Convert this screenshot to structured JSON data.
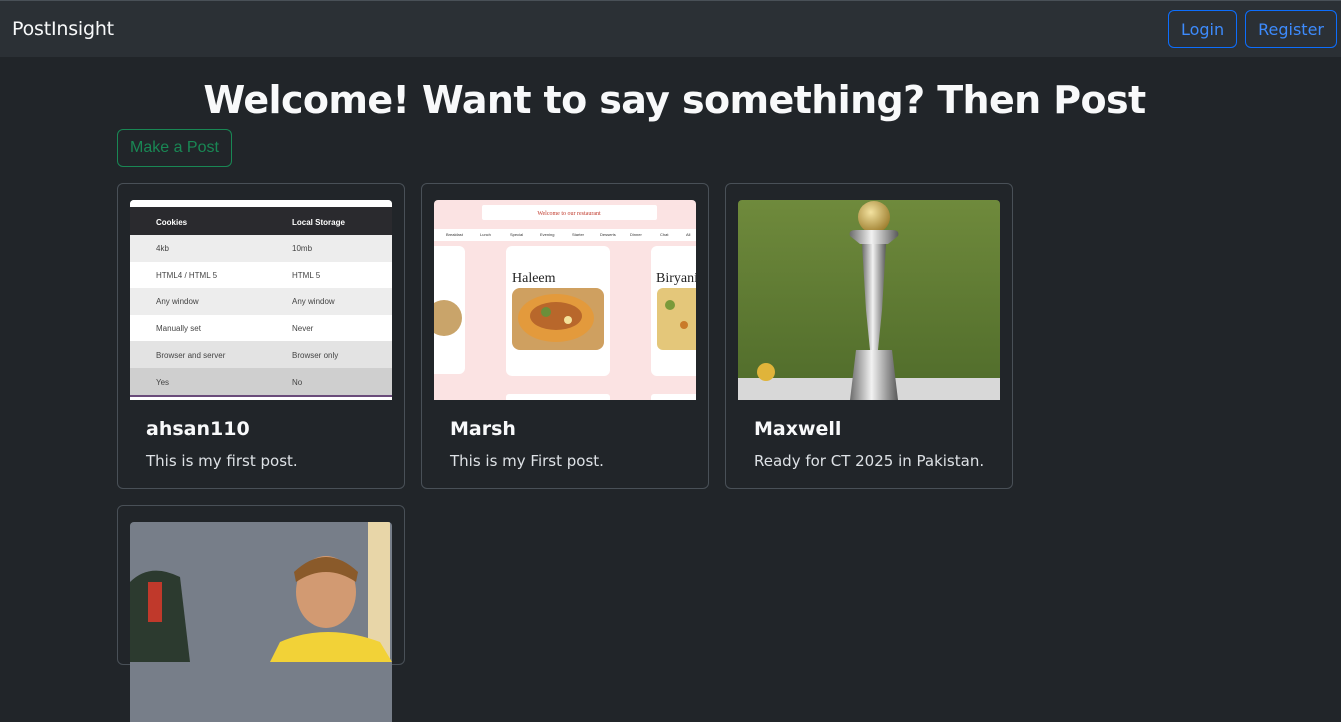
{
  "navbar": {
    "brand": "PostInsight",
    "login_label": "Login",
    "register_label": "Register"
  },
  "main": {
    "title": "Welcome! Want to say something? Then Post",
    "make_post_label": "Make a Post"
  },
  "posts": [
    {
      "author": "ahsan110",
      "text": "This is my first post.",
      "image": {
        "kind": "table-screenshot",
        "headers": [
          "Cookies",
          "Local Storage"
        ],
        "rows": [
          [
            "4kb",
            "10mb"
          ],
          [
            "HTML4 / HTML 5",
            "HTML 5"
          ],
          [
            "Any window",
            "Any window"
          ],
          [
            "Manually set",
            "Never"
          ],
          [
            "Browser and server",
            "Browser only"
          ],
          [
            "Yes",
            "No"
          ]
        ]
      }
    },
    {
      "author": "Marsh",
      "text": "This is my First post.",
      "image": {
        "kind": "restaurant-screenshot",
        "banner": "Welcome to our restaurant",
        "categories": [
          "Breakfast",
          "Lunch",
          "Special",
          "Evening",
          "Starter",
          "Desserts",
          "Dinner",
          "Chat",
          "All"
        ],
        "dishes": [
          "Haleem",
          "Biryani"
        ]
      }
    },
    {
      "author": "Maxwell",
      "text": "Ready for CT 2025 in Pakistan.",
      "image": {
        "kind": "trophy-photo"
      }
    },
    {
      "author": "",
      "text": "",
      "image": {
        "kind": "cricketer-photo"
      }
    }
  ]
}
